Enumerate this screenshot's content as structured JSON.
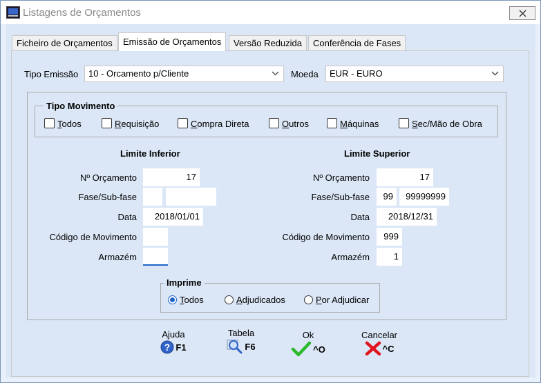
{
  "window": {
    "title": "Listagens de Orçamentos"
  },
  "tabs": [
    {
      "label": "Ficheiro de Orçamentos"
    },
    {
      "label": "Emissão de Orçamentos"
    },
    {
      "label": "Versão Reduzida"
    },
    {
      "label": "Conferência de Fases"
    }
  ],
  "form": {
    "tipo_emissao_label": "Tipo Emissão",
    "tipo_emissao_value": "10 - Orcamento p/Cliente",
    "moeda_label": "Moeda",
    "moeda_value": "EUR - EURO"
  },
  "tipo_movimento": {
    "legend": "Tipo Movimento",
    "options": [
      {
        "label": "Todos",
        "accel": "T",
        "rest": "odos",
        "checked": false
      },
      {
        "label": "Requisição",
        "accel": "R",
        "rest": "equisição",
        "checked": false
      },
      {
        "label": "Compra Direta",
        "accel": "C",
        "rest": "ompra Direta",
        "checked": false
      },
      {
        "label": "Outros",
        "accel": "O",
        "rest": "utros",
        "checked": false
      },
      {
        "label": "Máquinas",
        "accel": "M",
        "rest": "áquinas",
        "checked": false
      },
      {
        "label": "Sec/Mão de Obra",
        "accel": "S",
        "rest": "ec/Mão de Obra",
        "checked": false
      }
    ]
  },
  "limite_inferior": {
    "header": "Limite Inferior",
    "orcamento_label": "Nº Orçamento",
    "orcamento": "17",
    "fase_label": "Fase/Sub-fase",
    "fase": "",
    "subfase": "",
    "data_label": "Data",
    "data": "2018/01/01",
    "codigo_label": "Código de Movimento",
    "codigo": "",
    "armazem_label": "Armazém",
    "armazem": ""
  },
  "limite_superior": {
    "header": "Limite Superior",
    "orcamento_label": "Nº Orçamento",
    "orcamento": "17",
    "fase_label": "Fase/Sub-fase",
    "fase": "99",
    "subfase": "99999999",
    "data_label": "Data",
    "data": "2018/12/31",
    "codigo_label": "Código de Movimento",
    "codigo": "999",
    "armazem_label": "Armazém",
    "armazem": "1"
  },
  "imprime": {
    "legend": "Imprime",
    "options": [
      {
        "label": "Todos",
        "accel": "T",
        "rest": "odos",
        "selected": true
      },
      {
        "label": "Adjudicados",
        "accel": "A",
        "rest": "djudicados",
        "selected": false
      },
      {
        "label": "Por Adjudicar",
        "accel": "P",
        "rest": "or Adjudicar",
        "selected": false
      }
    ]
  },
  "buttons": {
    "ajuda": {
      "caption": "Ajuda",
      "key": "F1",
      "icon": "help-icon"
    },
    "tabela": {
      "caption": "Tabela",
      "key": "F6",
      "icon": "magnifier-icon"
    },
    "ok": {
      "caption": "Ok",
      "key": "^O",
      "icon": "check-icon"
    },
    "cancelar": {
      "caption": "Cancelar",
      "key": "^C",
      "icon": "x-icon"
    }
  },
  "colors": {
    "accent": "#1e64c8",
    "ok": "#2db82d",
    "cancel": "#e0141e",
    "panel": "#dbe7f6"
  }
}
